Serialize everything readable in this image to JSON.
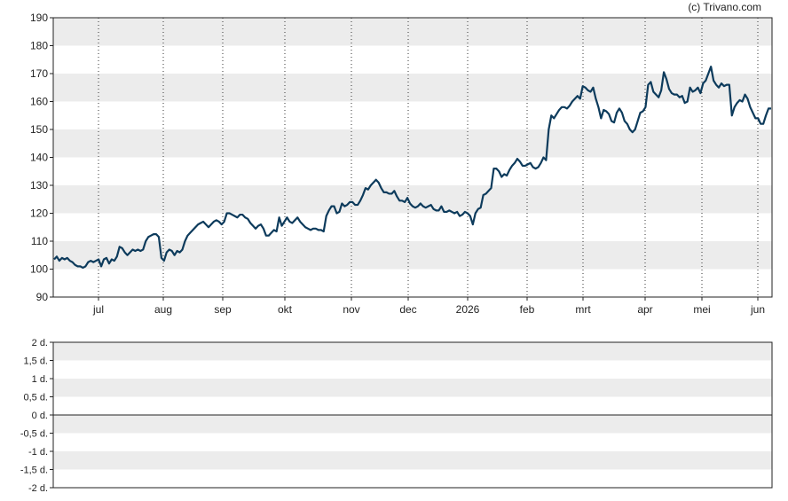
{
  "copyright": "(c) Trivano.com",
  "chart_data": [
    {
      "type": "line",
      "grid": true,
      "ylim": [
        90,
        190
      ],
      "y_ticks": [
        "190",
        "180",
        "170",
        "160",
        "150",
        "140",
        "130",
        "120",
        "110",
        "100",
        "90"
      ],
      "x_month_labels": [
        "jul",
        "aug",
        "sep",
        "okt",
        "nov",
        "dec",
        "2026",
        "feb",
        "mrt",
        "apr",
        "mei",
        "jun"
      ],
      "line_color": "#0d3b5c",
      "series": [
        {
          "values": [
            103.5,
            104.5,
            103,
            104,
            103.5,
            104,
            103,
            102.5,
            101.5,
            101,
            101,
            100.5,
            101,
            102.5,
            103,
            102.5,
            103,
            103.5,
            101,
            103.5,
            104,
            102,
            103.5,
            103,
            104.5,
            108,
            107.5,
            106,
            105,
            106,
            107,
            106.5,
            107,
            106.5,
            107,
            110,
            111.5,
            112,
            112.5,
            112.5,
            111.5,
            104,
            103,
            106,
            107,
            106.5,
            105,
            106.5,
            106,
            107,
            110,
            112,
            113,
            114,
            115,
            116,
            116.5,
            117,
            116,
            115,
            116,
            117,
            117.5,
            117,
            116,
            117,
            120,
            120,
            119.5,
            119,
            118.5,
            119.5,
            119.5,
            118.5,
            118,
            116.5,
            115.5,
            114.5,
            115.5,
            116,
            114.5,
            112,
            112,
            113,
            114,
            113.5,
            118.5,
            115.5,
            117,
            118.5,
            117,
            116.5,
            117.5,
            118.5,
            117,
            116,
            115,
            114.5,
            114,
            114.5,
            114.5,
            114,
            114,
            113.5,
            119,
            121,
            122.5,
            122.5,
            120,
            120.5,
            123.5,
            122.5,
            123,
            124,
            124,
            123,
            123,
            124.5,
            126.5,
            129,
            128.5,
            130,
            131,
            132,
            131,
            129,
            127.5,
            127.5,
            127,
            127,
            128,
            126,
            124.5,
            124.5,
            124,
            125.5,
            123.5,
            122.5,
            122,
            122.5,
            123.5,
            122.5,
            122,
            122.5,
            123,
            121.5,
            121,
            121,
            122.5,
            120.5,
            120.5,
            121,
            120.5,
            120,
            120.5,
            119,
            119.5,
            120.5,
            120,
            119,
            116,
            120,
            121.5,
            122,
            126.5,
            127,
            128,
            129,
            136,
            136,
            135,
            133,
            134,
            133.5,
            135.5,
            137,
            138,
            139.5,
            138.5,
            137,
            137,
            137.5,
            138,
            136.5,
            136,
            136.5,
            138,
            140,
            139,
            150,
            155,
            154,
            155.5,
            157,
            158,
            158,
            157.5,
            158.5,
            160,
            161,
            162,
            161,
            165.5,
            165,
            164,
            163.5,
            165,
            161,
            158,
            154,
            157,
            156.5,
            155.5,
            153,
            152.5,
            156,
            157.5,
            156,
            153,
            152,
            150,
            149,
            150,
            153,
            156,
            156.5,
            158,
            166,
            167,
            163.5,
            162.5,
            161.5,
            164,
            170.5,
            168,
            164.5,
            163,
            162.5,
            162.5,
            161.5,
            162,
            159.5,
            160,
            165,
            163.5,
            164,
            165,
            163,
            166.5,
            167.5,
            170,
            172.5,
            167.5,
            166,
            165,
            166.5,
            165.5,
            166,
            166,
            155,
            158,
            159.5,
            160.5,
            160,
            162.5,
            161,
            158,
            156,
            154,
            154,
            152,
            152,
            155,
            157.5,
            157.5
          ]
        }
      ]
    },
    {
      "type": "line",
      "grid": true,
      "ylim": [
        -2,
        2
      ],
      "y_ticks": [
        "2 d.",
        "1,5 d.",
        "1 d.",
        "0,5 d.",
        "0 d.",
        "-0,5 d.",
        "-1 d.",
        "-1,5 d.",
        "-2 d."
      ],
      "series": []
    }
  ]
}
